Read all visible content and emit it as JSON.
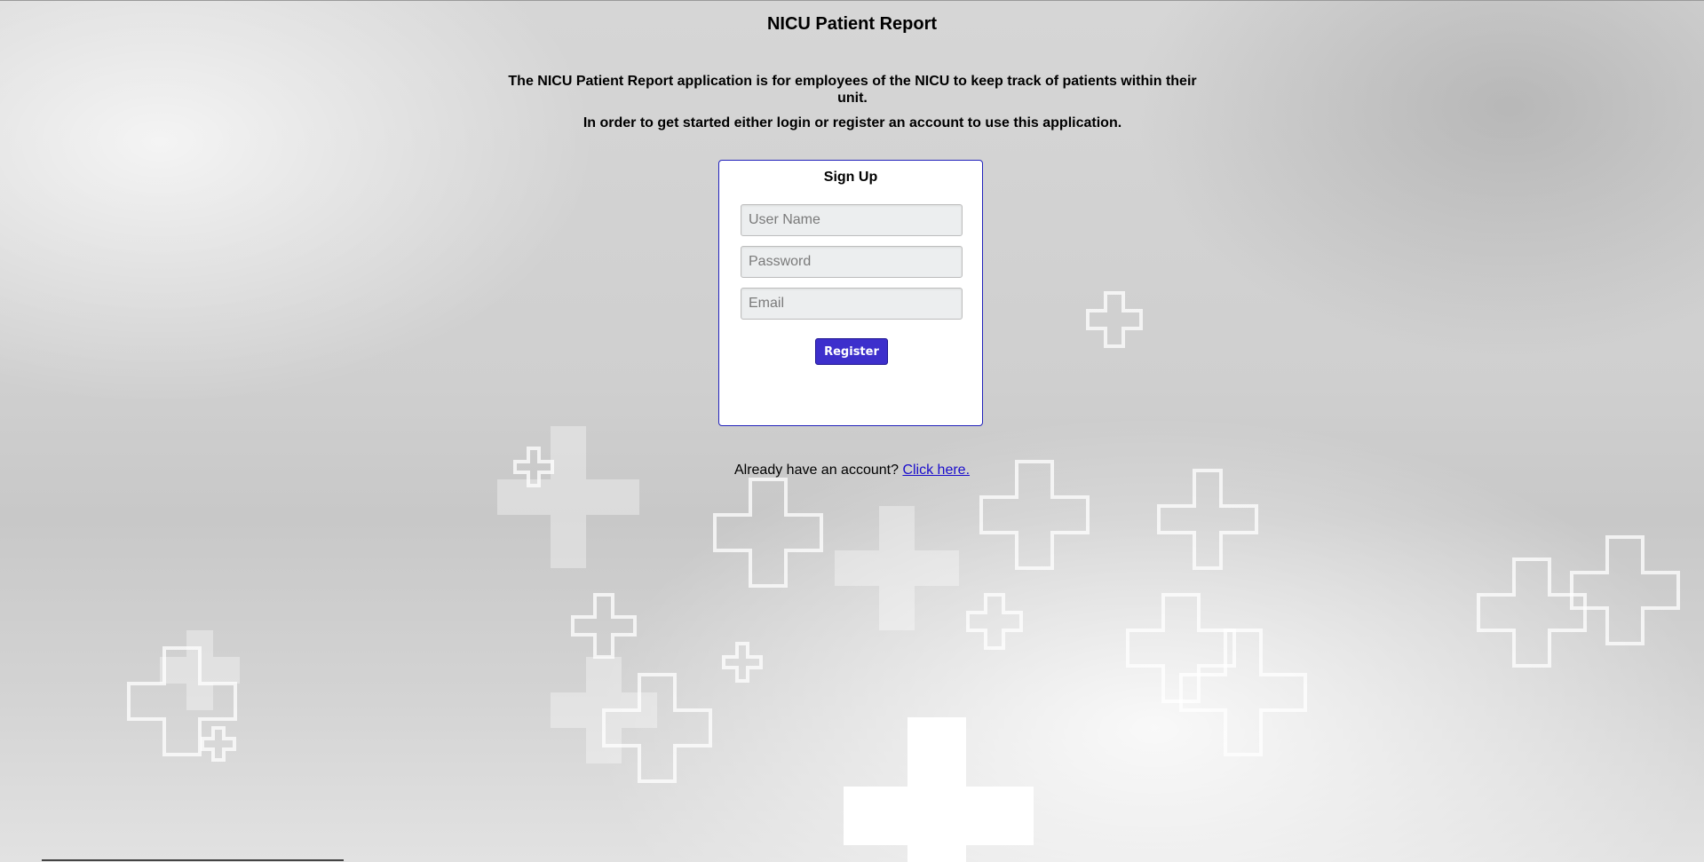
{
  "page": {
    "title": "NICU Patient Report",
    "intro_line_1": "The NICU Patient Report application is for employees of the NICU to keep track of patients within their unit.",
    "intro_line_2": "In order to get started either login or register an account to use this application."
  },
  "signup": {
    "title": "Sign Up",
    "username_placeholder": "User Name",
    "password_placeholder": "Password",
    "email_placeholder": "Email",
    "register_label": "Register"
  },
  "footer": {
    "prompt": "Already have an account?",
    "link_text": "Click here."
  },
  "colors": {
    "accent": "#3d2fcc",
    "card_border": "#2222bb",
    "link": "#1a0dcc"
  },
  "icons": {
    "background": "medical-cross-icon"
  }
}
